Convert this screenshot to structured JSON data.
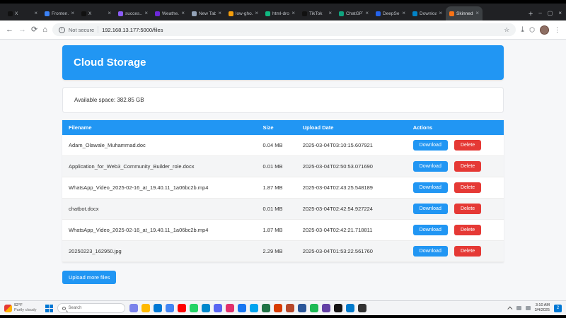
{
  "colors": {
    "accent": "#2196f3",
    "danger": "#e53935"
  },
  "browser": {
    "tabs": [
      {
        "label": "X",
        "fav": "#111111",
        "active": false
      },
      {
        "label": "Fronten...",
        "fav": "#3b82f6",
        "active": false
      },
      {
        "label": "X",
        "fav": "#111111",
        "active": false
      },
      {
        "label": "succes...",
        "fav": "#8b5cf6",
        "active": false
      },
      {
        "label": "Weathe...",
        "fav": "#6d28d9",
        "active": false
      },
      {
        "label": "New Tab",
        "fav": "#94a3b8",
        "active": false
      },
      {
        "label": "low-gho...",
        "fav": "#f59e0b",
        "active": false
      },
      {
        "label": "html-dro...",
        "fav": "#10b981",
        "active": false
      },
      {
        "label": "TikTok",
        "fav": "#111111",
        "active": false
      },
      {
        "label": "ChatGPT",
        "fav": "#10a37f",
        "active": false
      },
      {
        "label": "DeepSe...",
        "fav": "#2563eb",
        "active": false
      },
      {
        "label": "Downloa...",
        "fav": "#0284c7",
        "active": false
      },
      {
        "label": "Skinned...",
        "fav": "#f97316",
        "active": true
      }
    ],
    "security_label": "Not secure",
    "url": "192.168.13.177:5000/files"
  },
  "page": {
    "title": "Cloud Storage",
    "available_space": "Available space: 382.85 GB",
    "table": {
      "headers": {
        "filename": "Filename",
        "size": "Size",
        "date": "Upload Date",
        "actions": "Actions"
      },
      "download_label": "Download",
      "delete_label": "Delete"
    },
    "files": [
      {
        "name": "Adam_Olawale_Muhammad.doc",
        "size": "0.04 MB",
        "date": "2025-03-04T03:10:15.607921"
      },
      {
        "name": "Application_for_Web3_Community_Builder_role.docx",
        "size": "0.01 MB",
        "date": "2025-03-04T02:50:53.071690"
      },
      {
        "name": "WhatsApp_Video_2025-02-16_at_19.40.11_1a06bc2b.mp4",
        "size": "1.87 MB",
        "date": "2025-03-04T02:43:25.548189"
      },
      {
        "name": "chatbot.docx",
        "size": "0.01 MB",
        "date": "2025-03-04T02:42:54.927224"
      },
      {
        "name": "WhatsApp_Video_2025-02-16_at_19.40.11_1a06bc2b.mp4",
        "size": "1.87 MB",
        "date": "2025-03-04T02:42:21.718811"
      },
      {
        "name": "20250223_162950.jpg",
        "size": "2.29 MB",
        "date": "2025-03-04T01:53:22.561760"
      }
    ],
    "upload_button": "Upload more files"
  },
  "taskbar": {
    "weather": {
      "temp": "92°F",
      "condition": "Partly cloudy"
    },
    "search_placeholder": "Search",
    "apps": [
      {
        "name": "teams",
        "color": "#7b83eb"
      },
      {
        "name": "file-explorer",
        "color": "#ffb900"
      },
      {
        "name": "edge",
        "color": "#0078d4"
      },
      {
        "name": "chrome",
        "color": "#4285f4"
      },
      {
        "name": "youtube",
        "color": "#ff0000"
      },
      {
        "name": "whatsapp",
        "color": "#25d366"
      },
      {
        "name": "telegram",
        "color": "#0088cc"
      },
      {
        "name": "discord",
        "color": "#5865f2"
      },
      {
        "name": "instagram",
        "color": "#e1306c"
      },
      {
        "name": "facebook",
        "color": "#1877f2"
      },
      {
        "name": "store",
        "color": "#00a4ef"
      },
      {
        "name": "excel",
        "color": "#217346"
      },
      {
        "name": "outlook",
        "color": "#d83b01"
      },
      {
        "name": "powerpoint",
        "color": "#b7472a"
      },
      {
        "name": "word",
        "color": "#2b579a"
      },
      {
        "name": "spotify",
        "color": "#1db954"
      },
      {
        "name": "twitch",
        "color": "#6441a5"
      },
      {
        "name": "github",
        "color": "#171515"
      },
      {
        "name": "vscode",
        "color": "#007acc"
      },
      {
        "name": "terminal",
        "color": "#333333"
      }
    ],
    "clock": {
      "time": "3:10 AM",
      "date": "3/4/2025"
    }
  }
}
